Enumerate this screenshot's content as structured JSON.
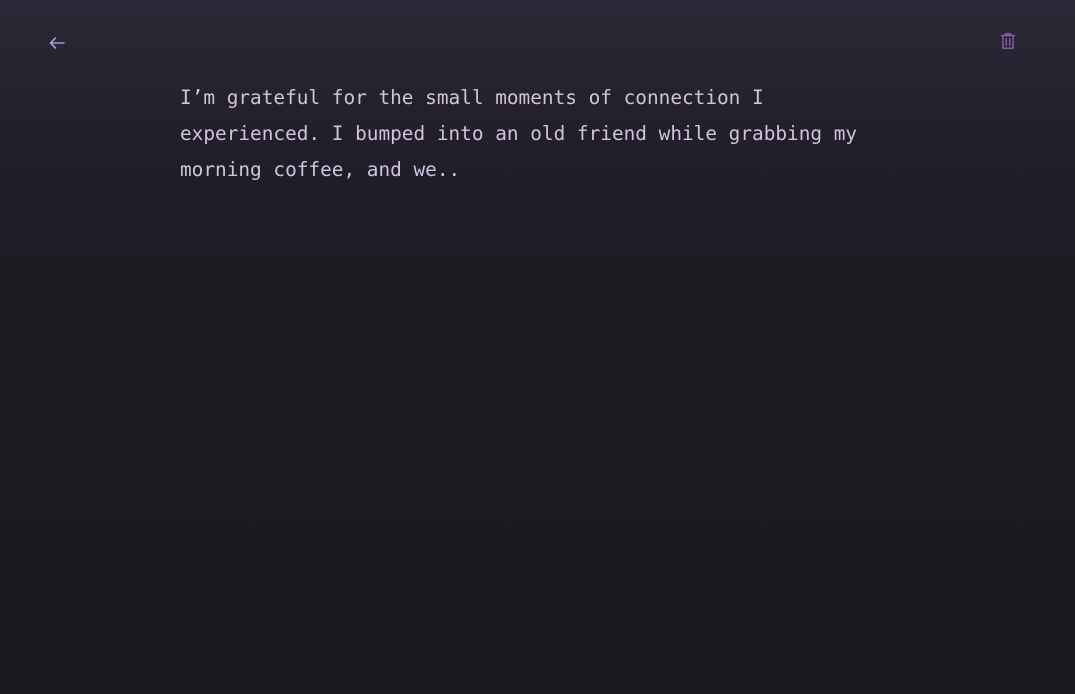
{
  "toolbar": {
    "back_icon": "arrow-left-icon",
    "delete_icon": "trash-icon"
  },
  "entry": {
    "text": "I’m grateful for the small moments of connection I experienced. I bumped into an old friend while grabbing my morning coffee, and we.."
  },
  "colors": {
    "background_top": "#2c2837",
    "background_bottom": "#1b191e",
    "text": "#cfc4df",
    "icon_back": "#a897d4",
    "icon_delete": "#7e5fb0"
  }
}
